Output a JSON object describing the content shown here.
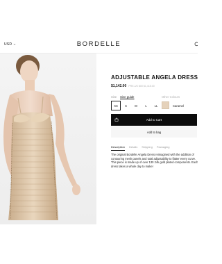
{
  "header": {
    "currency": "USD",
    "logo": "BORDELLE"
  },
  "product": {
    "title": "ADJUSTABLE ANGELA DRESS",
    "price": "$1,142.00",
    "price_note": "PRE-US $00 $1,415.00",
    "size_label": "Size",
    "size_guide_label": "Size guide",
    "sizes": [
      "XS",
      "S",
      "M",
      "L",
      "LL"
    ],
    "selected_size": "XS",
    "colours_label": "Other Colours",
    "colour_name": "Caramel",
    "colour_hex": "#e5d2bb",
    "add_to_cart_label": "Add to Cart",
    "add_to_bag_label": "Add to bag"
  },
  "tabs": [
    "Description",
    "Details",
    "Shipping",
    "Packaging"
  ],
  "active_tab": "Description",
  "description": "The original Bordelle Angela Dress reimagined with the addition of contouring mesh panels and total adjustability to flatter every curve. This piece is made up of over 130 24k gold plated components. Each dress takes a whole day to make!"
}
